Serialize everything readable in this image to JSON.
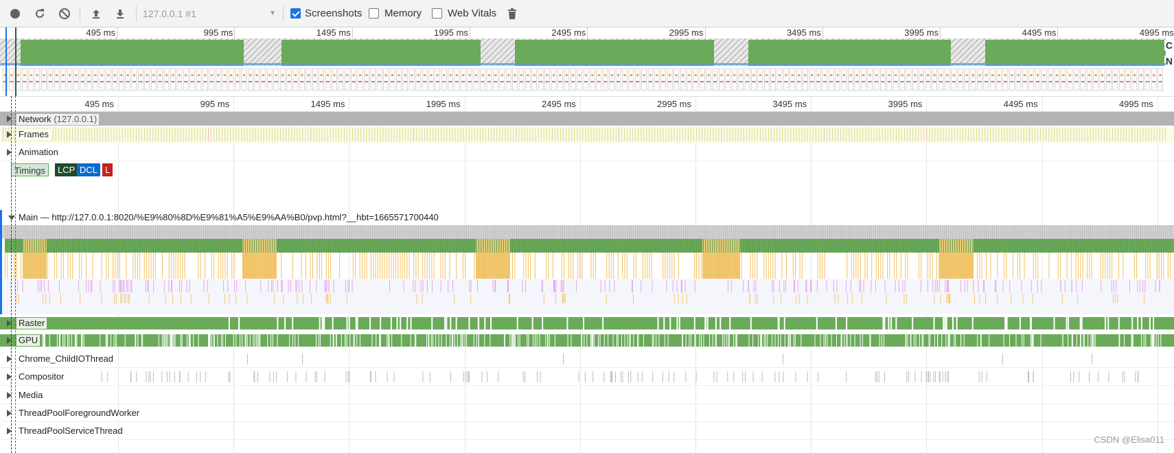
{
  "toolbar": {
    "target_label": "127.0.0.1 #1",
    "checkboxes": [
      {
        "label": "Screenshots",
        "checked": true
      },
      {
        "label": "Memory",
        "checked": false
      },
      {
        "label": "Web Vitals",
        "checked": false
      }
    ]
  },
  "ruler_ticks": [
    "495 ms",
    "995 ms",
    "1495 ms",
    "1995 ms",
    "2495 ms",
    "2995 ms",
    "3495 ms",
    "3995 ms",
    "4495 ms",
    "4995 ms"
  ],
  "overview": {
    "cpu_label": "C",
    "net_label": "N"
  },
  "tracks": {
    "network": {
      "label": "Network",
      "host": "(127.0.0.1)"
    },
    "frames": {
      "label": "Frames"
    },
    "animation": {
      "label": "Animation"
    },
    "timings": {
      "label": "Timings",
      "badges": [
        {
          "text": "LCP",
          "color": "#1e4b2c"
        },
        {
          "text": "DCL",
          "color": "#0b6bcb"
        },
        {
          "text": "L",
          "color": "#c5221f"
        }
      ]
    },
    "main": {
      "label": "Main — http://127.0.0.1:8020/%E9%80%8D%E9%81%A5%E9%AA%B0/pvp.html?__hbt=1665571700440"
    },
    "raster": {
      "label": "Raster"
    },
    "gpu": {
      "label": "GPU"
    },
    "threads": [
      {
        "label": "Chrome_ChildIOThread"
      },
      {
        "label": "Compositor"
      },
      {
        "label": "Media"
      },
      {
        "label": "ThreadPoolForegroundWorker"
      },
      {
        "label": "ThreadPoolServiceThread"
      }
    ]
  },
  "colors": {
    "scripting_green": "#6aaa5a",
    "rendering_yellow": "#f2c66d",
    "painting_purple": "#e2a8e8",
    "idle_gray": "#c8c8c8",
    "network_gray": "#b3b3b3"
  },
  "watermark": "CSDN @Elisa011"
}
